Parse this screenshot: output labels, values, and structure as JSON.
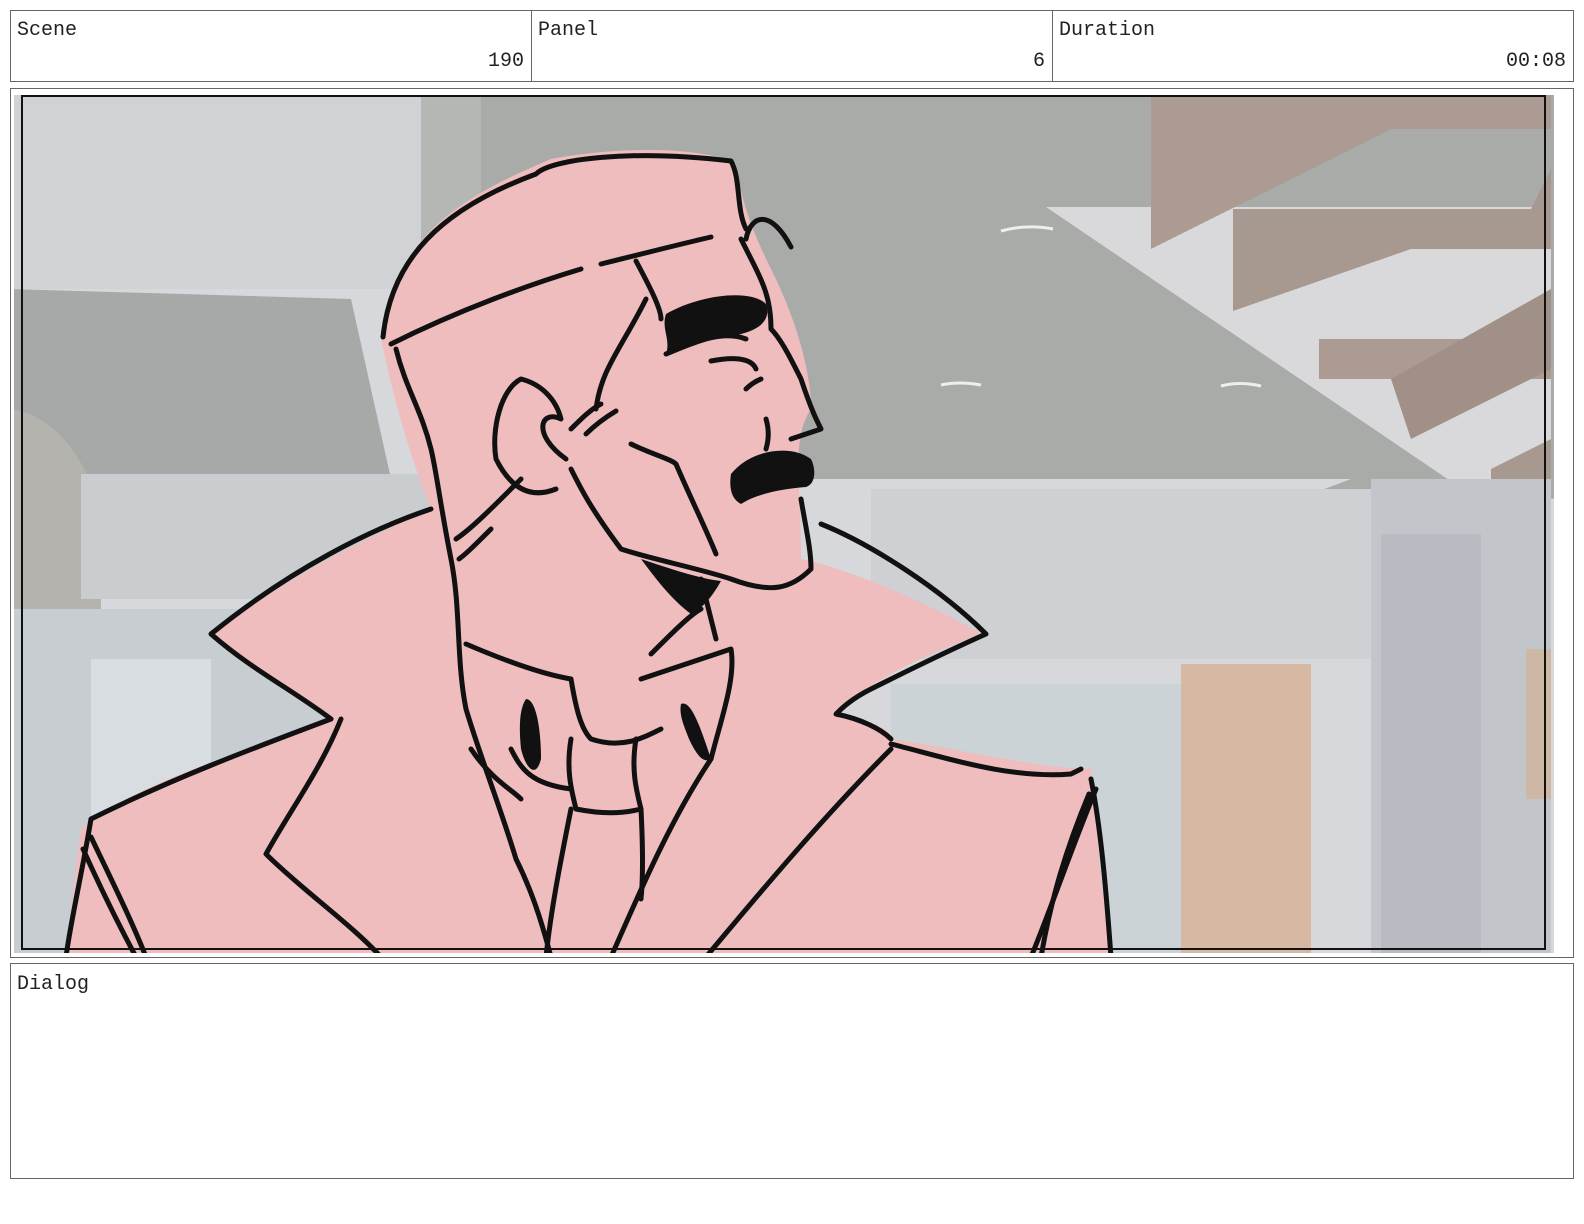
{
  "header": {
    "scene": {
      "label": "Scene",
      "value": "190"
    },
    "panel": {
      "label": "Panel",
      "value": "6"
    },
    "duration": {
      "label": "Duration",
      "value": "00:08"
    }
  },
  "panel_image": {
    "content": "storyboard-sketch-man-with-mustache-in-trench-coat",
    "colors": {
      "fill": "#efbdbd",
      "line": "#111111",
      "wall": "#d7d8db",
      "ceiling": "#a9aba9",
      "stairs": "#ab9b93"
    }
  },
  "dialog": {
    "label": "Dialog",
    "text": ""
  }
}
